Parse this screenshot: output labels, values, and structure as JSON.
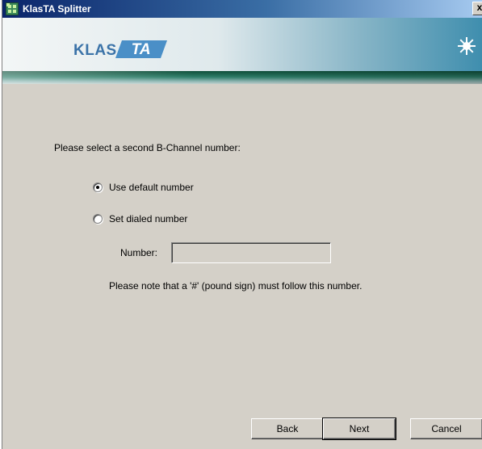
{
  "window": {
    "title": "KlasTA Splitter",
    "close_label": "x"
  },
  "banner": {
    "logo_klas": "KLAS",
    "logo_ta": "TA",
    "icon": "sun-icon"
  },
  "content": {
    "prompt": "Please select a second B-Channel number:",
    "options": [
      {
        "label": "Use default number",
        "checked": true
      },
      {
        "label": "Set dialed number",
        "checked": false
      }
    ],
    "number_label": "Number:",
    "number_value": "",
    "note": "Please note that a '#' (pound sign) must follow this number."
  },
  "buttons": {
    "back": "Back",
    "next": "Next",
    "cancel": "Cancel"
  },
  "colors": {
    "dialog_bg": "#d4d0c8",
    "titlebar_start": "#0a246a",
    "logo_blue": "#3b73a8",
    "stripe_green": "#2d7d68"
  }
}
